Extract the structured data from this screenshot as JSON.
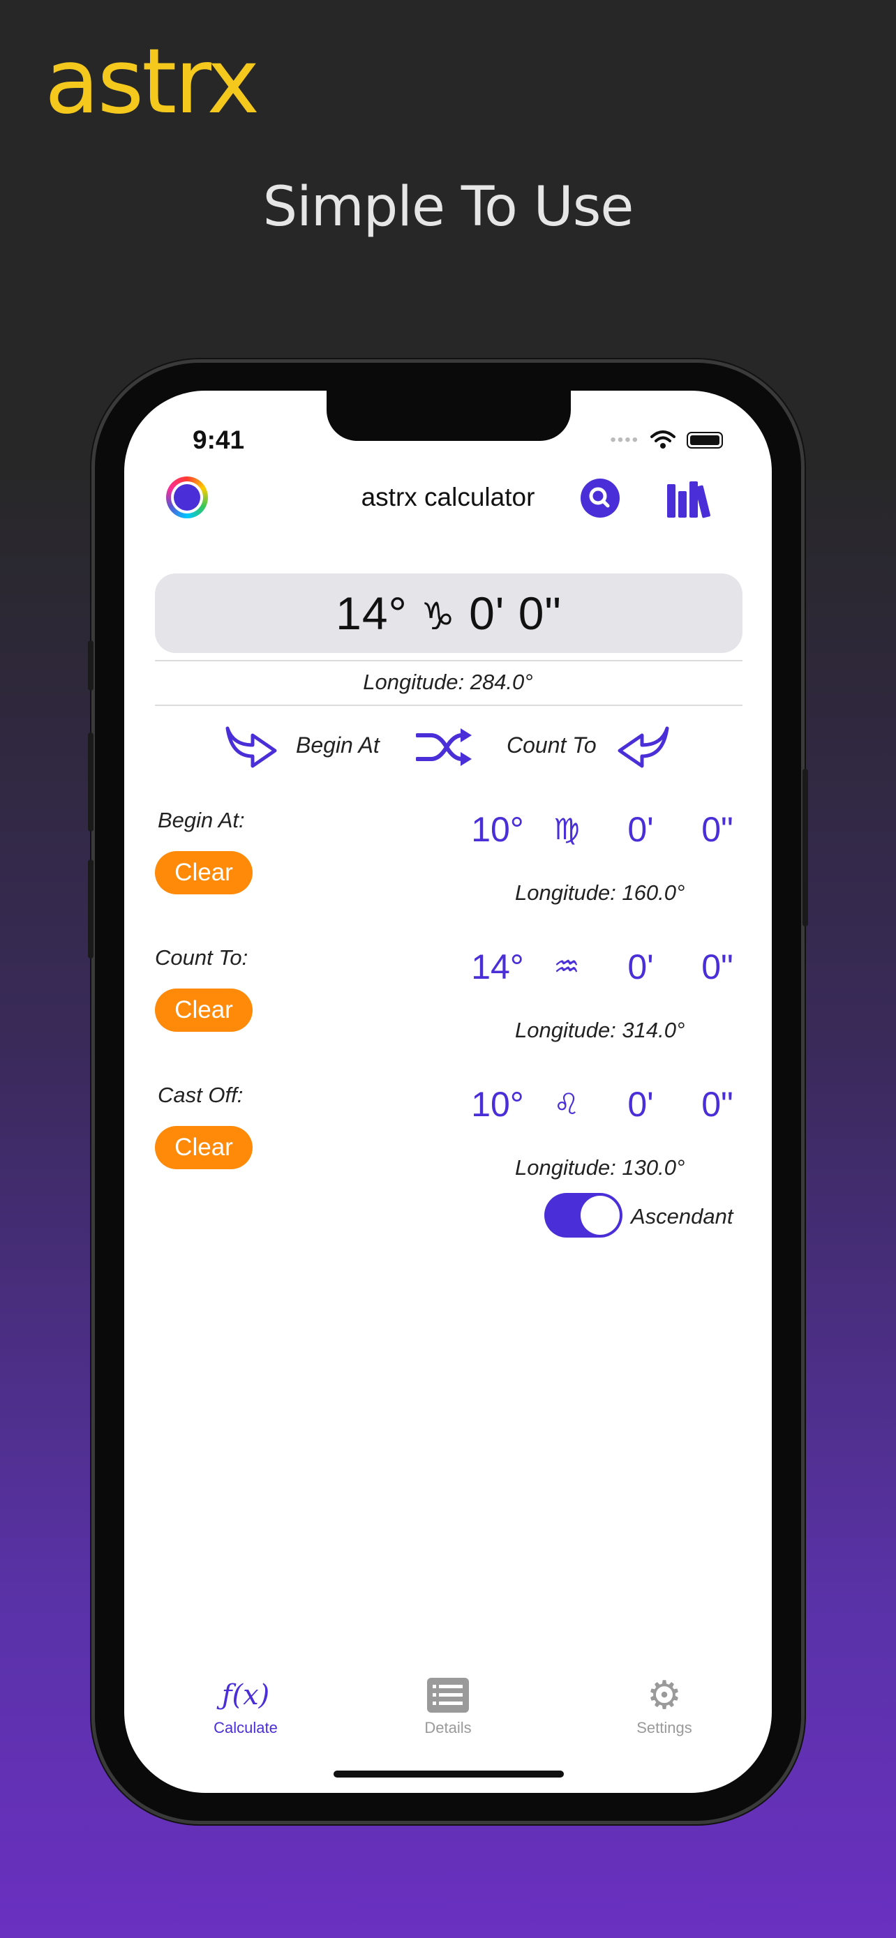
{
  "promo": {
    "brand": "astrx",
    "tagline": "Simple To Use"
  },
  "status_bar": {
    "time": "9:41"
  },
  "nav": {
    "title": "astrx calculator"
  },
  "result": {
    "degree": "14°",
    "sign_glyph": "♑",
    "minutes": "0'",
    "seconds": "0\"",
    "longitude": "Longitude: 284.0°"
  },
  "direction": {
    "begin_label": "Begin At",
    "count_label": "Count To"
  },
  "rows": [
    {
      "label": "Begin At:",
      "clear": "Clear",
      "deg": "10°",
      "sign": "♍",
      "min": "0'",
      "sec": "0\"",
      "longitude": "Longitude: 160.0°"
    },
    {
      "label": "Count To:",
      "clear": "Clear",
      "deg": "14°",
      "sign": "♒",
      "min": "0'",
      "sec": "0\"",
      "longitude": "Longitude: 314.0°"
    },
    {
      "label": "Cast Off:",
      "clear": "Clear",
      "deg": "10°",
      "sign": "♌",
      "min": "0'",
      "sec": "0\"",
      "longitude": "Longitude: 130.0°"
    }
  ],
  "ascendant": {
    "label": "Ascendant",
    "on": true
  },
  "tabs": [
    {
      "label": "Calculate",
      "icon": "function-icon",
      "icon_text": "ƒ(x)",
      "active": true
    },
    {
      "label": "Details",
      "icon": "list-icon",
      "active": false
    },
    {
      "label": "Settings",
      "icon": "gear-icon",
      "active": false
    }
  ],
  "colors": {
    "accent": "#4a2fd8",
    "clear": "#ff8a0a",
    "brand": "#f4c81c"
  }
}
